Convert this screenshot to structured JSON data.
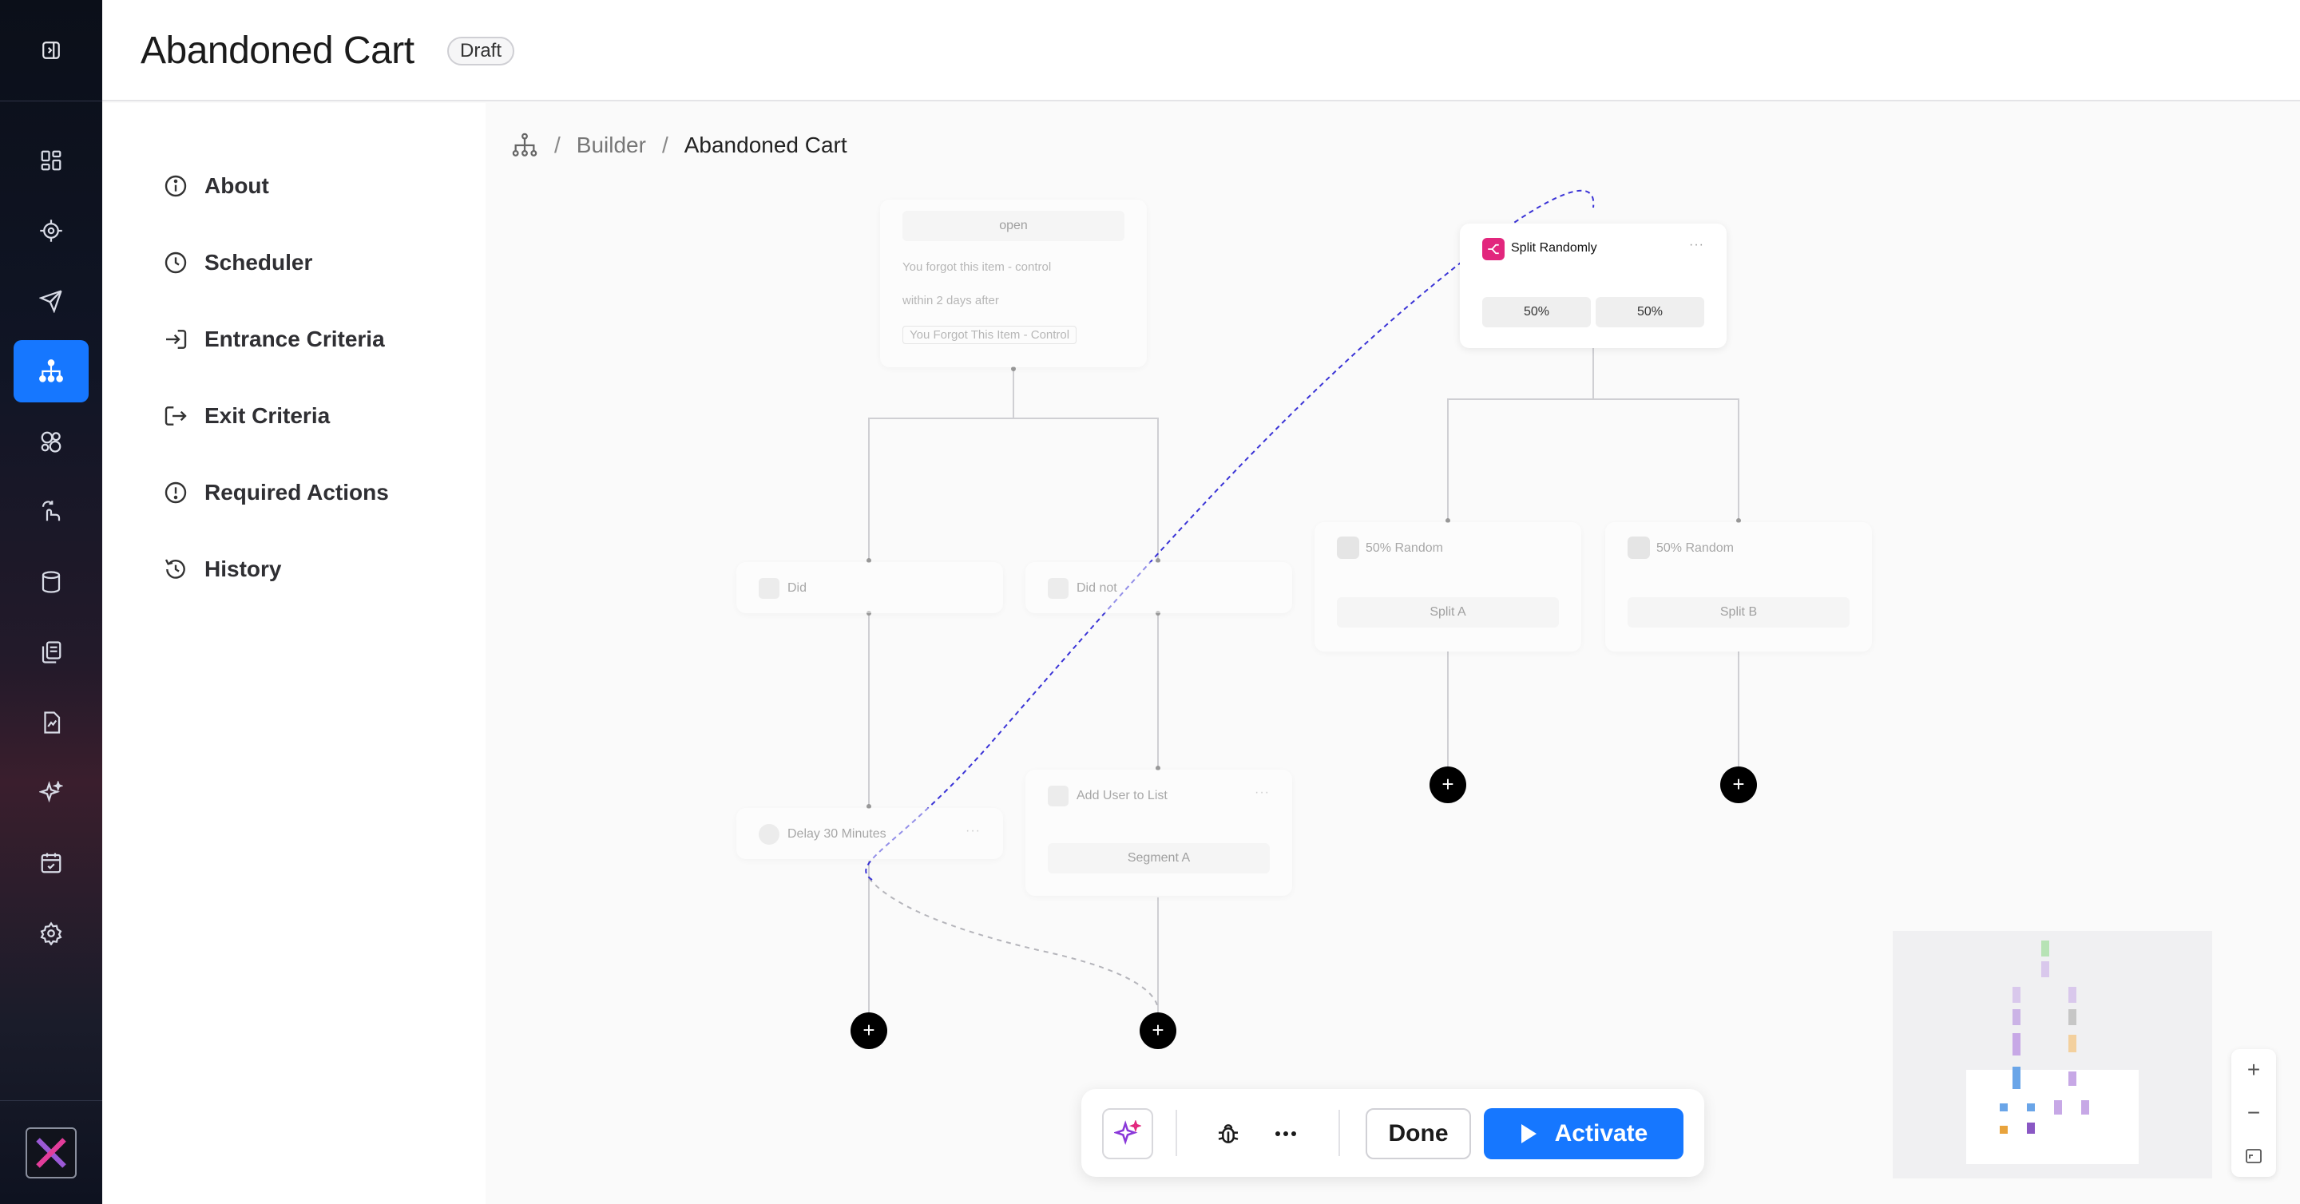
{
  "header": {
    "title": "Abandoned Cart",
    "status": "Draft"
  },
  "rail": {
    "items": [
      {
        "icon": "dashboard-icon"
      },
      {
        "icon": "target-icon"
      },
      {
        "icon": "send-icon"
      },
      {
        "icon": "journey-icon",
        "active": true
      },
      {
        "icon": "segments-icon"
      },
      {
        "icon": "hand-icon"
      },
      {
        "icon": "database-icon"
      },
      {
        "icon": "templates-icon"
      },
      {
        "icon": "report-icon"
      },
      {
        "icon": "sparkle-icon"
      },
      {
        "icon": "calendar-icon"
      },
      {
        "icon": "settings-icon"
      }
    ],
    "accent": "#1677ff"
  },
  "menu": {
    "about": "About",
    "scheduler": "Scheduler",
    "entrance": "Entrance Criteria",
    "exit": "Exit Criteria",
    "required": "Required Actions",
    "history": "History"
  },
  "breadcrumb": {
    "parent": "Builder",
    "current": "Abandoned Cart"
  },
  "flow": {
    "top_node": {
      "event": "open",
      "line1": "You forgot this item - control",
      "line2": "within 2 days after",
      "tag": "You Forgot This Item - Control"
    },
    "did": "Did",
    "did_not": "Did not",
    "delay": "Delay 30 Minutes",
    "add_to_list": {
      "title": "Add User to List",
      "segment": "Segment A"
    },
    "split": {
      "title": "Split Randomly",
      "a": "50%",
      "b": "50%"
    },
    "random_a": {
      "title": "50% Random",
      "label": "Split A"
    },
    "random_b": {
      "title": "50% Random",
      "label": "Split B"
    },
    "more": "···",
    "plus": "+"
  },
  "toolbar": {
    "done": "Done",
    "activate": "Activate"
  },
  "zoom": {
    "in": "+",
    "out": "−"
  }
}
